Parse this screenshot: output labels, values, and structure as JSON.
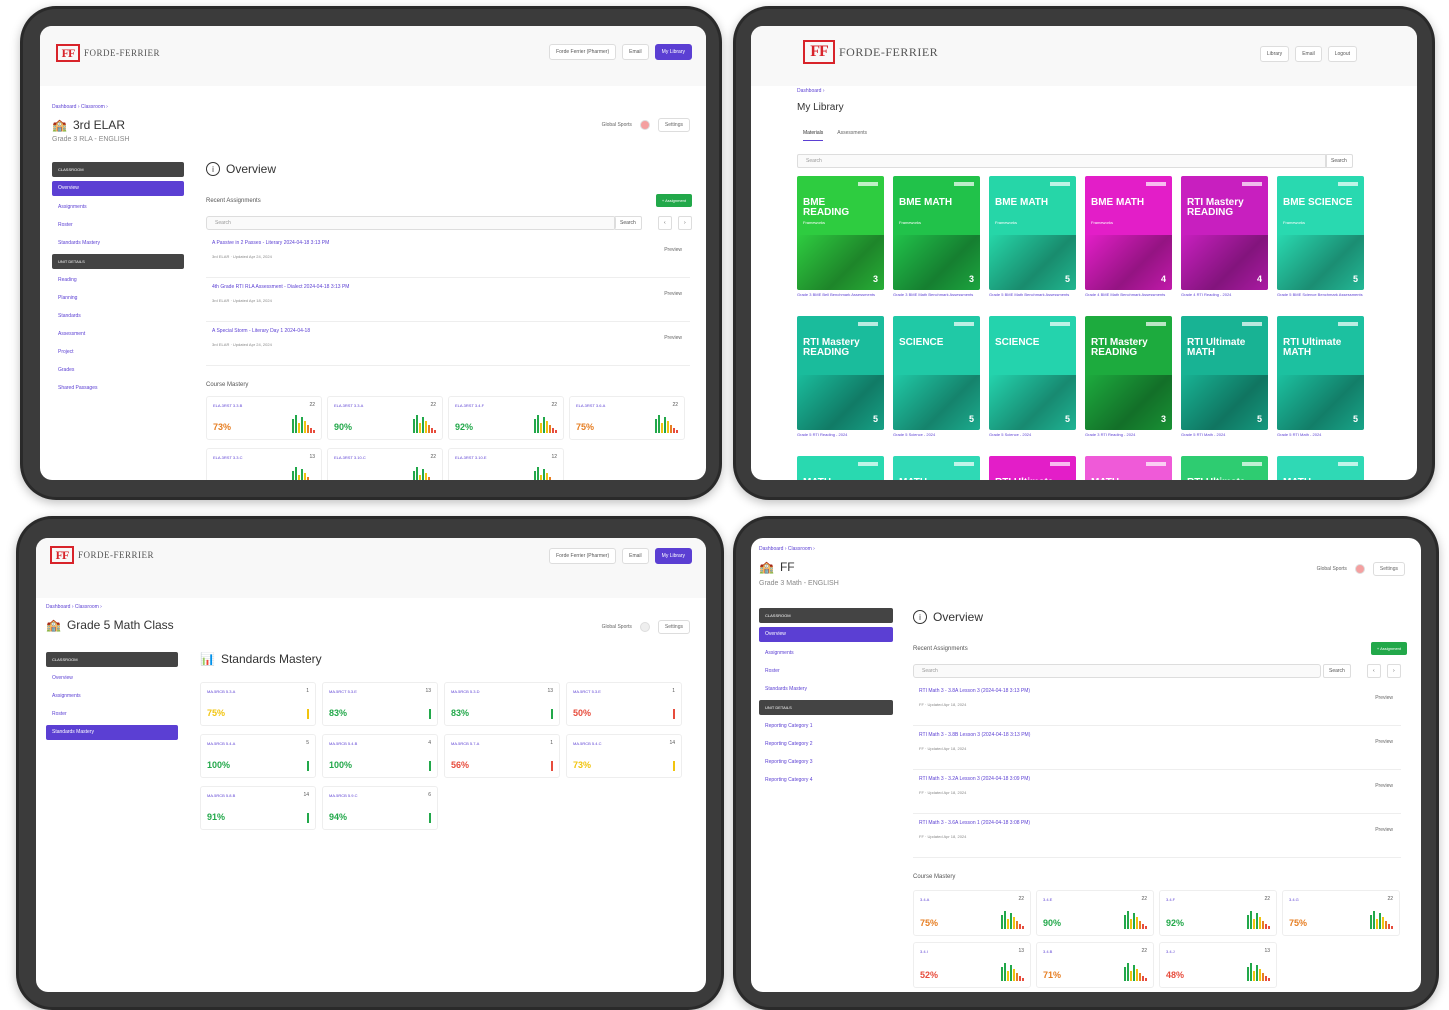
{
  "brand": {
    "mark": "FF",
    "name": "FORDE-FERRIER"
  },
  "colors": {
    "accent": "#5b3fd3",
    "green": "#22a84a",
    "orange": "#e74c3c",
    "teal": "#1abc9c"
  },
  "panel1": {
    "nav": [
      "Forde Ferrier (Pharmer)",
      "Email",
      "My Library"
    ],
    "breadcrumb": "Dashboard  ›  Classroom  ›",
    "title": "3rd ELAR",
    "subtitle": "Grade 3 RLA - ENGLISH",
    "tools": [
      "Global Sports",
      "Settings"
    ],
    "sidebar": {
      "classroom_header": "CLASSROOM",
      "classroom_items": [
        "Overview",
        "Assignments",
        "Roster",
        "Standards Mastery"
      ],
      "unit_header": "UNIT DETAILS",
      "unit_items": [
        "Reading",
        "Planning",
        "Standards",
        "Assessment",
        "Project",
        "Grades",
        "Shared Passages"
      ]
    },
    "section": "Overview",
    "recent_label": "Recent Assignments",
    "add_button": "+ Assignment",
    "search_placeholder": "Search",
    "search_button": "Search",
    "assignments": [
      {
        "title": "A Passive in 2 Passes - Literary 2024-04-18 3:13 PM",
        "meta": "3rd ELAR  ·  Updated Apr 24, 2024",
        "action": "Preview"
      },
      {
        "title": "4th Grade RTI RLA Assessment - Dialect 2024-04-18 3:13 PM",
        "meta": "3rd ELAR  ·  Updated Apr 18, 2024",
        "action": "Preview"
      },
      {
        "title": "A Special Storm - Literary Day 1 2024-04-18",
        "meta": "3rd ELAR  ·  Updated Apr 24, 2024",
        "action": "Preview"
      }
    ],
    "mastery_label": "Course Mastery",
    "mastery": [
      {
        "code": "ELA.3RST 3.3.B",
        "count": "22",
        "pct": "73%",
        "color": "#e67e22"
      },
      {
        "code": "ELA.3RST 3.3.A",
        "count": "22",
        "pct": "90%",
        "color": "#22a84a"
      },
      {
        "code": "ELA.3RST 3.4.F",
        "count": "22",
        "pct": "92%",
        "color": "#22a84a"
      },
      {
        "code": "ELA.3RST 3.6.A",
        "count": "22",
        "pct": "75%",
        "color": "#e67e22"
      },
      {
        "code": "ELA.3RST 3.3.C",
        "count": "13",
        "pct": "",
        "color": "#e67e22"
      },
      {
        "code": "ELA.3RST 3.10.C",
        "count": "22",
        "pct": "",
        "color": "#e67e22"
      },
      {
        "code": "ELA.3RST 3.10.E",
        "count": "12",
        "pct": "",
        "color": "#e67e22"
      }
    ]
  },
  "panel2": {
    "nav": [
      "Library",
      "Email",
      "Logout"
    ],
    "breadcrumb": "Dashboard  ›",
    "title": "My Library",
    "tabs": [
      "Materials",
      "Assessments"
    ],
    "search_placeholder": "Search",
    "search_button": "Search",
    "books": [
      {
        "title": "BME READING",
        "sub": "Frameworks",
        "num": "3",
        "color": "#2ecc40",
        "caption": "Grade 3 BME Bell Benchmark Assessments"
      },
      {
        "title": "BME MATH",
        "sub": "Frameworks",
        "num": "3",
        "color": "#21c24a",
        "caption": "Grade 3 BME Math Benchmark Assessments"
      },
      {
        "title": "BME MATH",
        "sub": "Frameworks",
        "num": "5",
        "color": "#26d6a8",
        "caption": "Grade 5 BME Math Benchmark Assessments"
      },
      {
        "title": "BME MATH",
        "sub": "Frameworks",
        "num": "4",
        "color": "#e31ec8",
        "caption": "Grade 4 BME Math Benchmark Assessments"
      },
      {
        "title": "RTI Mastery READING",
        "sub": "",
        "num": "4",
        "color": "#c81fbf",
        "caption": "Grade 4 RTI Reading - 2024"
      },
      {
        "title": "BME SCIENCE",
        "sub": "Frameworks",
        "num": "5",
        "color": "#29d9b0",
        "caption": "Grade 5 BME Science Benchmark Assessments"
      },
      {
        "title": "RTI Mastery READING",
        "sub": "",
        "num": "5",
        "color": "#1abc9c",
        "caption": "Grade 5 RTI Reading - 2024"
      },
      {
        "title": "SCIENCE",
        "sub": "",
        "num": "5",
        "color": "#20c9a6",
        "caption": "Grade 5 Science - 2024"
      },
      {
        "title": "SCIENCE",
        "sub": "",
        "num": "5",
        "color": "#24d3ad",
        "caption": "Grade 5 Science - 2024"
      },
      {
        "title": "RTI Mastery READING",
        "sub": "",
        "num": "3",
        "color": "#1dab3e",
        "caption": "Grade 3 RTI Reading - 2024"
      },
      {
        "title": "RTI Ultimate MATH",
        "sub": "",
        "num": "5",
        "color": "#18b394",
        "caption": "Grade 5 RTI Math - 2024"
      },
      {
        "title": "RTI Ultimate MATH",
        "sub": "",
        "num": "5",
        "color": "#1cc1a0",
        "caption": "Grade 5 RTI Math - 2024"
      },
      {
        "title": "MATH",
        "sub": "",
        "num": "",
        "color": "#29d9b0",
        "caption": ""
      },
      {
        "title": "MATH",
        "sub": "",
        "num": "",
        "color": "#2fd9b5",
        "caption": ""
      },
      {
        "title": "RTI Ultimate MATH",
        "sub": "",
        "num": "",
        "color": "#e31ec8",
        "caption": ""
      },
      {
        "title": "MATH",
        "sub": "",
        "num": "",
        "color": "#ef5ad8",
        "caption": ""
      },
      {
        "title": "RTI Ultimate MATH",
        "sub": "",
        "num": "",
        "color": "#2ecc71",
        "caption": ""
      },
      {
        "title": "MATH",
        "sub": "",
        "num": "",
        "color": "#2fd9b5",
        "caption": ""
      }
    ]
  },
  "panel3": {
    "nav": [
      "Forde Ferrier (Pharmer)",
      "Email",
      "My Library"
    ],
    "breadcrumb": "Dashboard  ›  Classroom  ›",
    "title": "Grade 5 Math Class",
    "tools": [
      "Global Sports",
      "Settings"
    ],
    "sidebar": {
      "classroom_header": "CLASSROOM",
      "items": [
        "Overview",
        "Assignments",
        "Roster"
      ],
      "active": "Standards Mastery"
    },
    "section": "Standards Mastery",
    "mastery": [
      {
        "code": "MA.5RCB 5.3.A",
        "count": "1",
        "pct": "75%",
        "color": "#f1c40f"
      },
      {
        "code": "MA.5RCT 5.3.E",
        "count": "13",
        "pct": "83%",
        "color": "#22a84a"
      },
      {
        "code": "MA.5RCB 5.3.D",
        "count": "13",
        "pct": "83%",
        "color": "#22a84a"
      },
      {
        "code": "MA.5RCT 5.3.E",
        "count": "1",
        "pct": "50%",
        "color": "#e74c3c"
      },
      {
        "code": "MA.5RCB 5.4.A",
        "count": "5",
        "pct": "100%",
        "color": "#22a84a"
      },
      {
        "code": "MA.5RCB 5.4.B",
        "count": "4",
        "pct": "100%",
        "color": "#22a84a"
      },
      {
        "code": "MA.5RCB 5.7.A",
        "count": "1",
        "pct": "56%",
        "color": "#e74c3c"
      },
      {
        "code": "MA.5RCB 5.4.C",
        "count": "14",
        "pct": "73%",
        "color": "#f1c40f"
      },
      {
        "code": "MA.5RCB 5.8.B",
        "count": "14",
        "pct": "91%",
        "color": "#22a84a"
      },
      {
        "code": "MA.5RCB 5.9.C",
        "count": "6",
        "pct": "94%",
        "color": "#22a84a"
      }
    ]
  },
  "panel4": {
    "breadcrumb": "Dashboard  ›  Classroom  ›",
    "title": "FF",
    "subtitle": "Grade 3 Math - ENGLISH",
    "tools": [
      "Global Sports",
      "Settings"
    ],
    "sidebar": {
      "classroom_header": "CLASSROOM",
      "classroom_items": [
        "Overview",
        "Assignments",
        "Roster",
        "Standards Mastery"
      ],
      "unit_header": "UNIT DETAILS",
      "unit_items": [
        "Reporting Category 1",
        "Reporting Category 2",
        "Reporting Category 3",
        "Reporting Category 4"
      ]
    },
    "section": "Overview",
    "recent_label": "Recent Assignments",
    "add_button": "+ Assignment",
    "search_placeholder": "Search",
    "search_button": "Search",
    "assignments": [
      {
        "title": "RTI Math 3 - 3.8A Lesson 3 (2024-04-18 3:13 PM)",
        "meta": "FF  ·  Updated Apr 18, 2024",
        "action": "Preview"
      },
      {
        "title": "RTI Math 3 - 3.8B Lesson 3 (2024-04-18 3:13 PM)",
        "meta": "FF  ·  Updated Apr 18, 2024",
        "action": "Preview"
      },
      {
        "title": "RTI Math 3 - 3.2A Lesson 3 (2024-04-18 3:09 PM)",
        "meta": "FF  ·  Updated Apr 18, 2024",
        "action": "Preview"
      },
      {
        "title": "RTI Math 3 - 3.6A Lesson 1 (2024-04-18 3:08 PM)",
        "meta": "FF  ·  Updated Apr 18, 2024",
        "action": "Preview"
      }
    ],
    "mastery_label": "Course Mastery",
    "mastery": [
      {
        "code": "3.4.A",
        "count": "22",
        "pct": "75%",
        "color": "#e67e22"
      },
      {
        "code": "3.4.E",
        "count": "22",
        "pct": "90%",
        "color": "#22a84a"
      },
      {
        "code": "3.4.F",
        "count": "22",
        "pct": "92%",
        "color": "#22a84a"
      },
      {
        "code": "3.4.G",
        "count": "22",
        "pct": "75%",
        "color": "#e67e22"
      },
      {
        "code": "3.4.I",
        "count": "13",
        "pct": "52%",
        "color": "#e74c3c"
      },
      {
        "code": "3.4.B",
        "count": "22",
        "pct": "71%",
        "color": "#e67e22"
      },
      {
        "code": "3.4.J",
        "count": "13",
        "pct": "48%",
        "color": "#e74c3c"
      }
    ]
  }
}
